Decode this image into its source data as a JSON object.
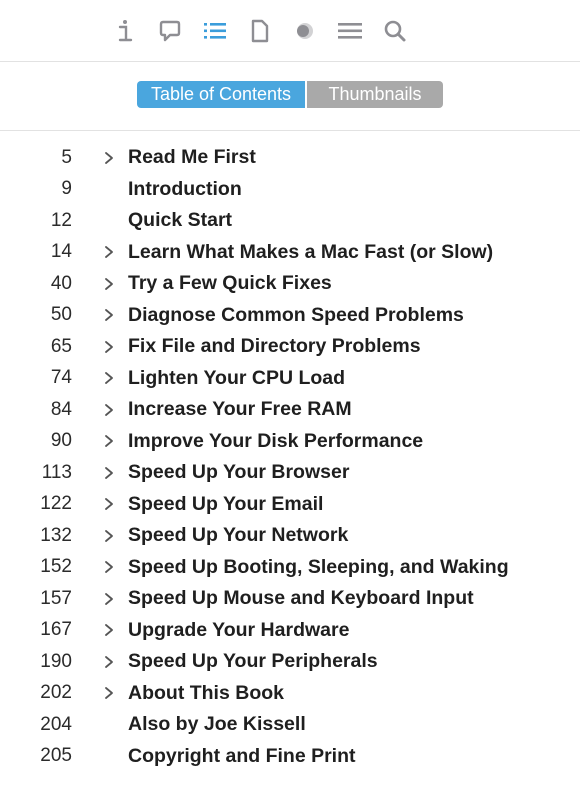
{
  "toolbar": {
    "buttons": [
      {
        "name": "info-icon",
        "active": false
      },
      {
        "name": "comment-bubble-icon",
        "active": false
      },
      {
        "name": "list-icon",
        "active": true
      },
      {
        "name": "page-icon",
        "active": false
      },
      {
        "name": "highlight-circle-icon",
        "active": false
      },
      {
        "name": "lines-icon",
        "active": false
      },
      {
        "name": "search-icon",
        "active": false
      }
    ],
    "icon_color": "#8e8e93",
    "active_color": "#3b9ddb"
  },
  "segmented": {
    "toc_label": "Table of Contents",
    "thumbs_label": "Thumbnails"
  },
  "toc": [
    {
      "page": "5",
      "title": "Read Me First",
      "expandable": true
    },
    {
      "page": "9",
      "title": "Introduction",
      "expandable": false
    },
    {
      "page": "12",
      "title": "Quick Start",
      "expandable": false
    },
    {
      "page": "14",
      "title": "Learn What Makes a Mac Fast (or Slow)",
      "expandable": true
    },
    {
      "page": "40",
      "title": "Try a Few Quick Fixes",
      "expandable": true
    },
    {
      "page": "50",
      "title": "Diagnose Common Speed Problems",
      "expandable": true
    },
    {
      "page": "65",
      "title": "Fix File and Directory Problems",
      "expandable": true
    },
    {
      "page": "74",
      "title": "Lighten Your CPU Load",
      "expandable": true
    },
    {
      "page": "84",
      "title": "Increase Your Free RAM",
      "expandable": true
    },
    {
      "page": "90",
      "title": "Improve Your Disk Performance",
      "expandable": true
    },
    {
      "page": "113",
      "title": "Speed Up Your Browser",
      "expandable": true
    },
    {
      "page": "122",
      "title": "Speed Up Your Email",
      "expandable": true
    },
    {
      "page": "132",
      "title": "Speed Up Your Network",
      "expandable": true
    },
    {
      "page": "152",
      "title": "Speed Up Booting, Sleeping, and Waking",
      "expandable": true
    },
    {
      "page": "157",
      "title": "Speed Up Mouse and Keyboard Input",
      "expandable": true
    },
    {
      "page": "167",
      "title": "Upgrade Your Hardware",
      "expandable": true
    },
    {
      "page": "190",
      "title": "Speed Up Your Peripherals",
      "expandable": true
    },
    {
      "page": "202",
      "title": "About This Book",
      "expandable": true
    },
    {
      "page": "204",
      "title": "Also by Joe Kissell",
      "expandable": false
    },
    {
      "page": "205",
      "title": "Copyright and Fine Print",
      "expandable": false
    }
  ]
}
